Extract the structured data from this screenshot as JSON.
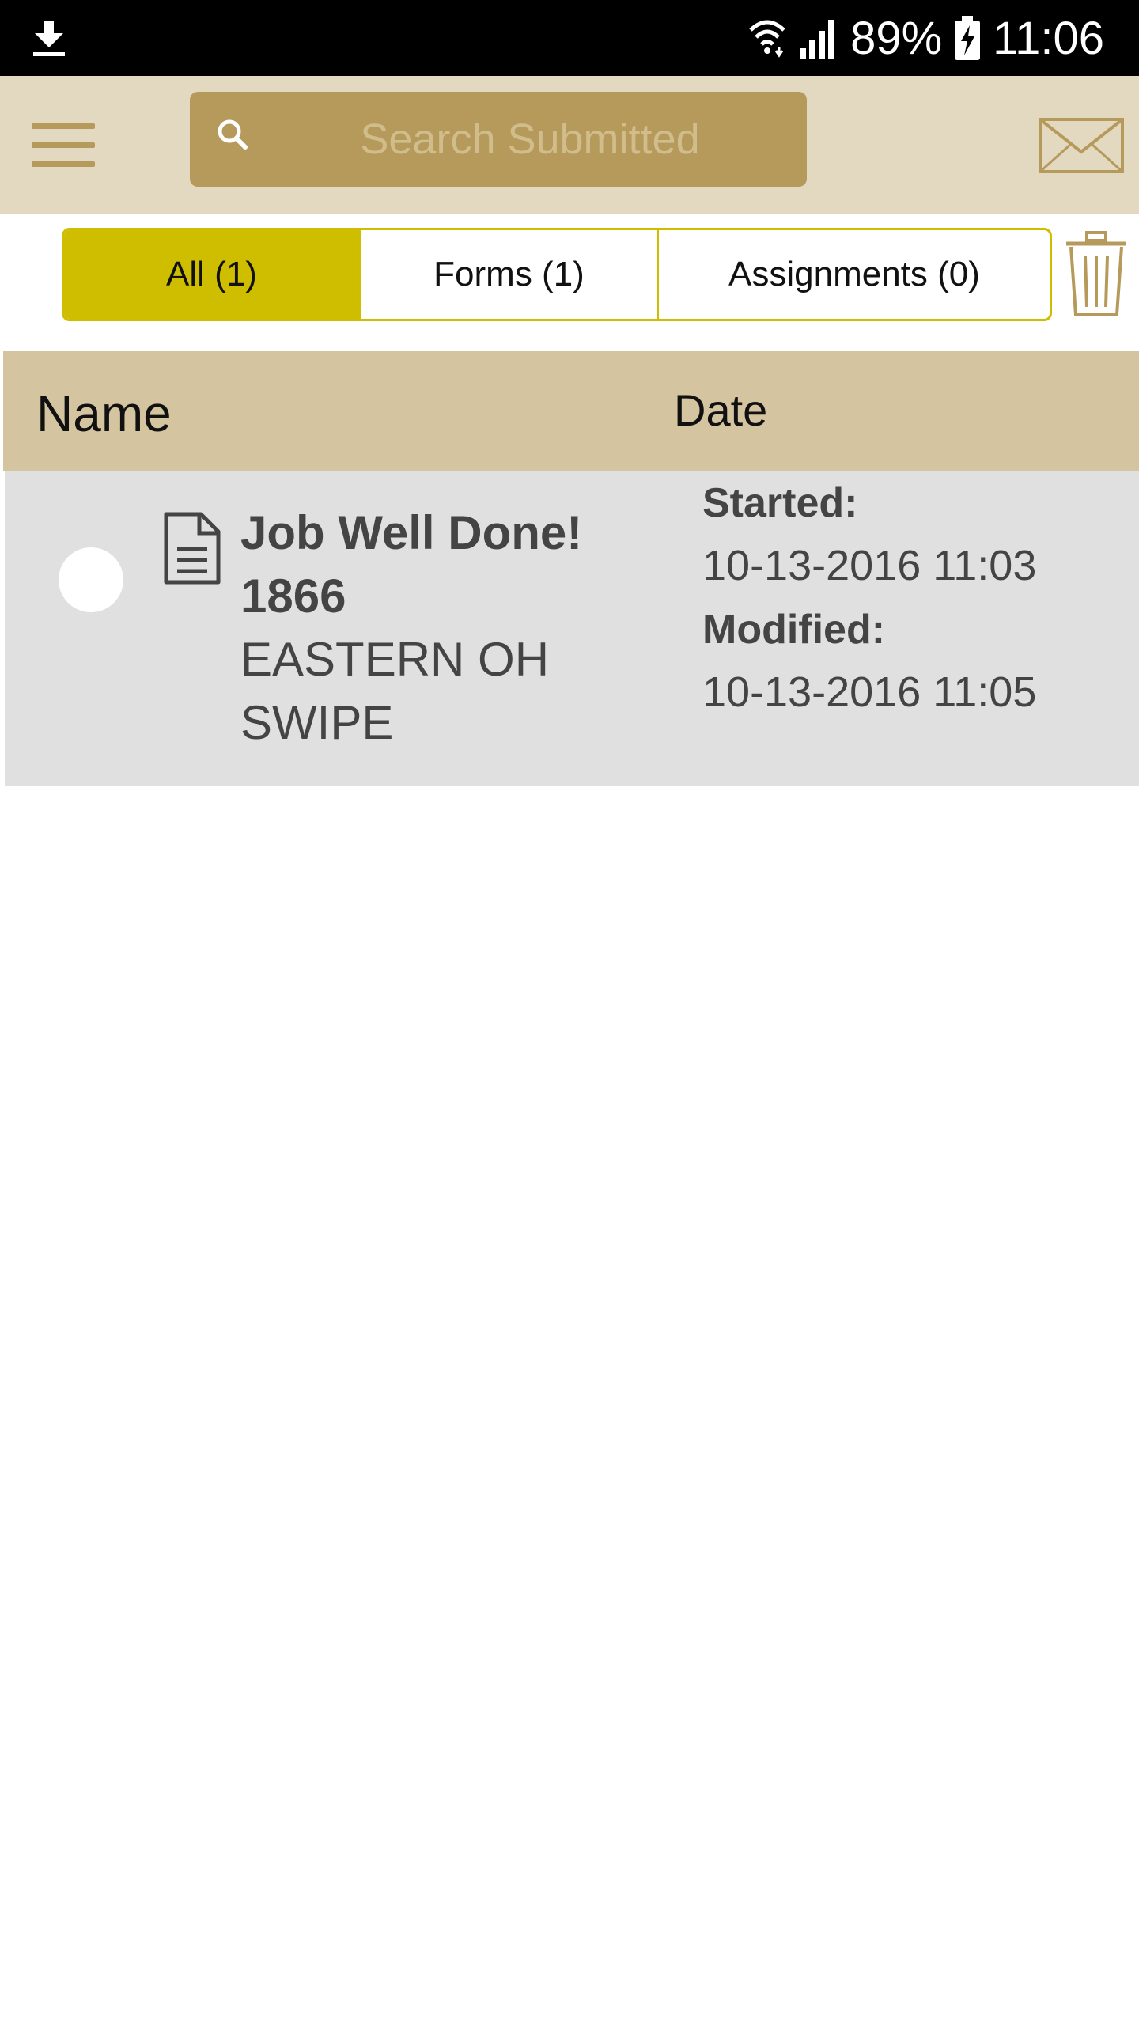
{
  "status_bar": {
    "battery_percent": "89%",
    "time": "11:06",
    "icons": [
      "download-icon",
      "wifi-icon",
      "signal-icon",
      "battery-charging-icon"
    ]
  },
  "app_bar": {
    "search_placeholder": "Search Submitted",
    "icons": [
      "menu-icon",
      "search-icon",
      "mail-icon"
    ]
  },
  "tabs": [
    {
      "label": "All (1)",
      "active": true
    },
    {
      "label": "Forms (1)",
      "active": false
    },
    {
      "label": "Assignments (0)",
      "active": false
    }
  ],
  "table": {
    "columns": {
      "name": "Name",
      "date": "Date"
    },
    "rows": [
      {
        "title_line1": "Job Well Done!",
        "title_line2": "1866",
        "subtitle_line1": "EASTERN OH",
        "subtitle_line2": "SWIPE",
        "started_label": "Started:",
        "started_value": "10-13-2016 11:03",
        "modified_label": "Modified:",
        "modified_value": "10-13-2016 11:05",
        "icon": "document-icon"
      }
    ]
  },
  "colors": {
    "accent_gold": "#b69a5c",
    "app_bar_bg": "#e3d9c0",
    "tab_active": "#cfbd00",
    "header_bg": "#d4c4a0",
    "row_bg": "#e0e0e0"
  }
}
